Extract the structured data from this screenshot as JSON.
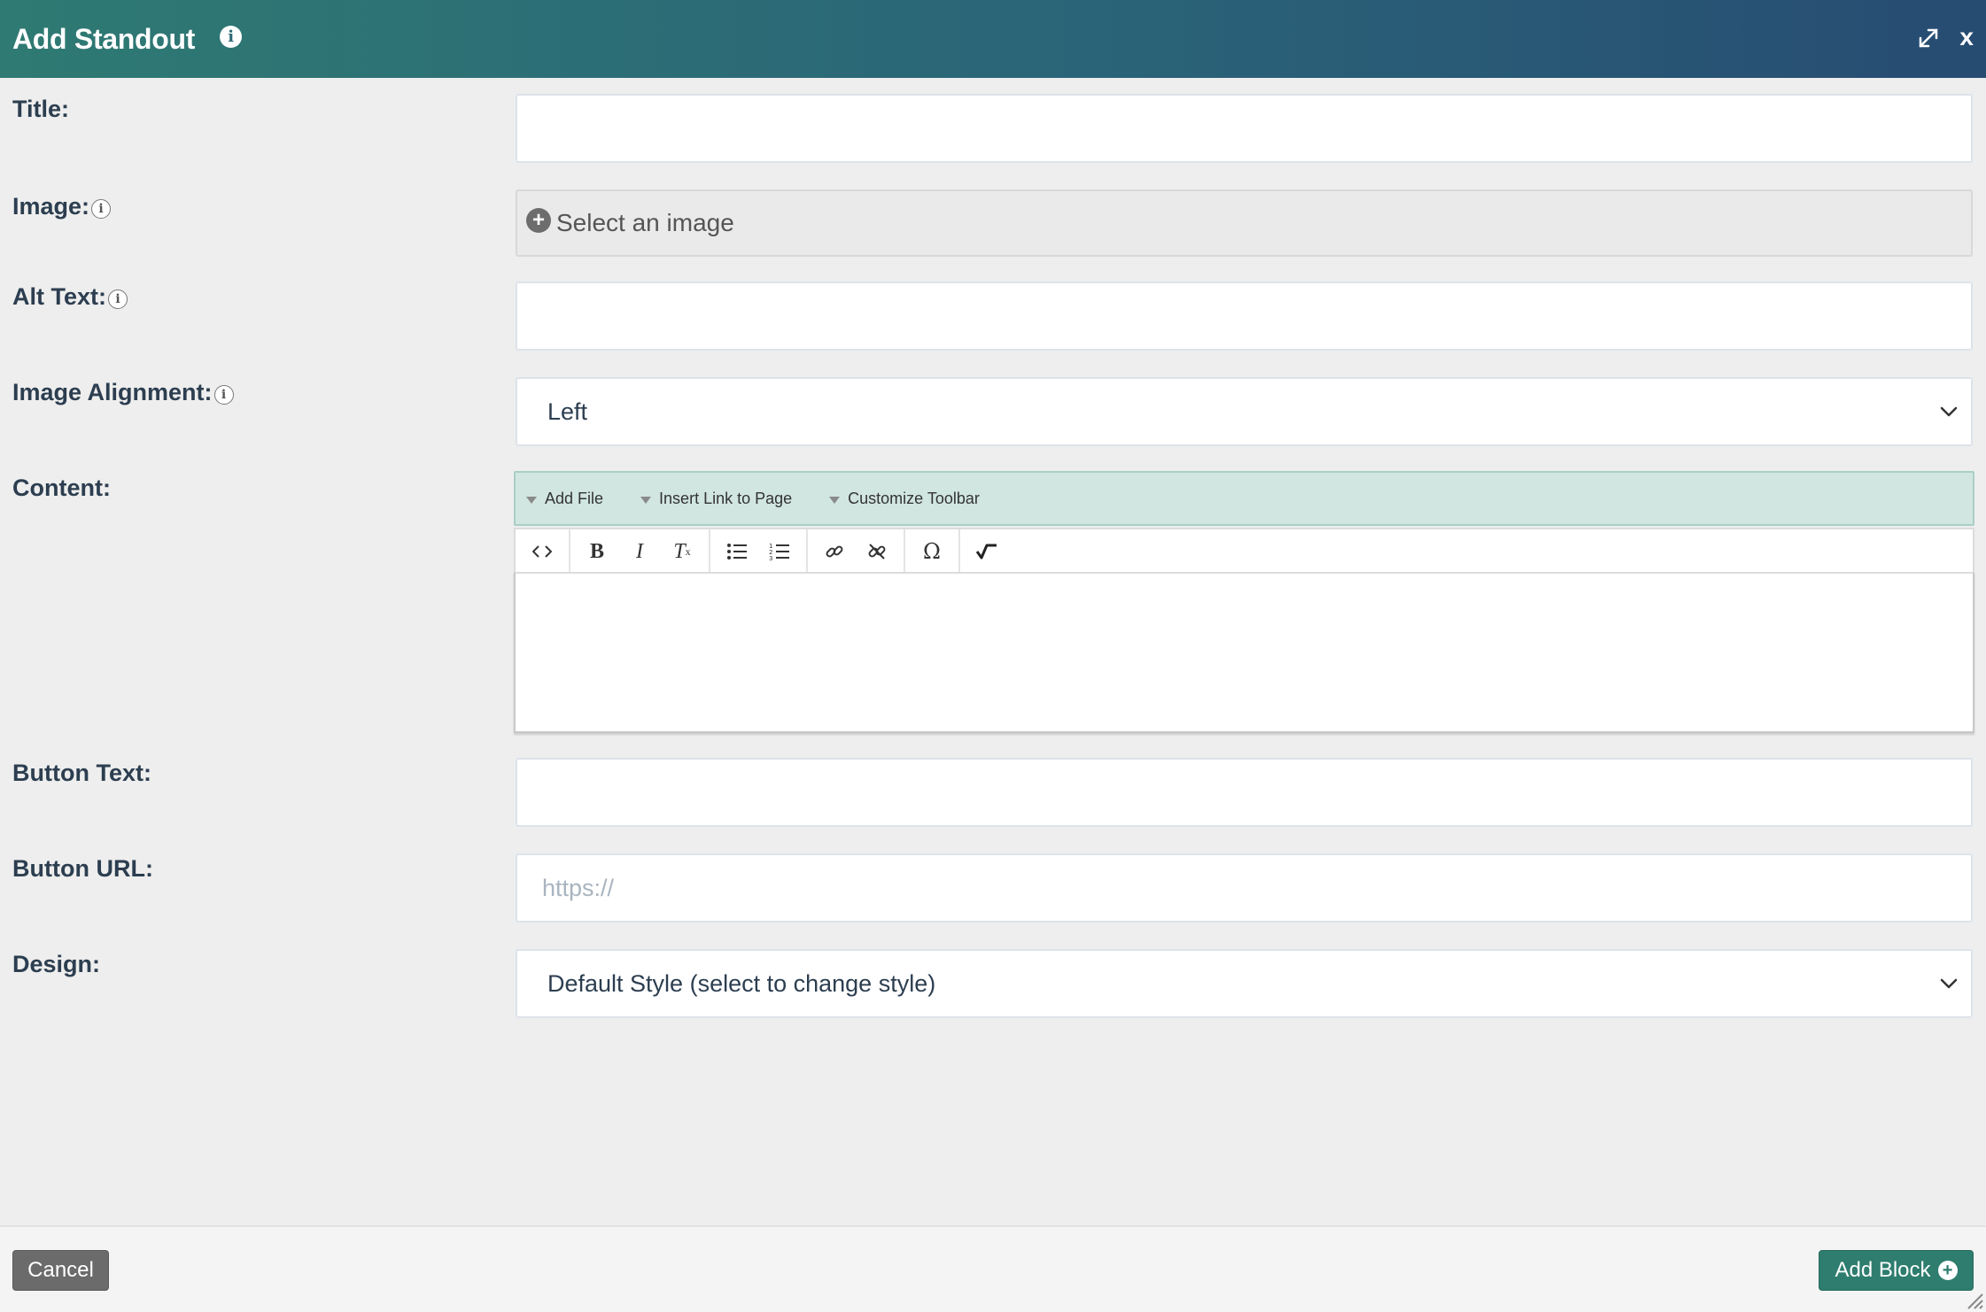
{
  "dialog": {
    "title": "Add Standout",
    "info_icon": "info-icon",
    "expand_icon": "expand-icon",
    "close_label": "x"
  },
  "form": {
    "title_label": "Title:",
    "title_value": "",
    "image_label": "Image:",
    "image_button": "Select an image",
    "alt_label": "Alt Text:",
    "alt_value": "",
    "alignment_label": "Image Alignment:",
    "alignment_value": "Left",
    "content_label": "Content:",
    "button_text_label": "Button Text:",
    "button_text_value": "",
    "button_url_label": "Button URL:",
    "button_url_placeholder": "https://",
    "design_label": "Design:",
    "design_value": "Default Style (select to change style)"
  },
  "editor": {
    "topbar": [
      {
        "label": "Add File"
      },
      {
        "label": "Insert Link to Page"
      },
      {
        "label": "Customize Toolbar"
      }
    ],
    "toolbar_icons": [
      "source-code-icon",
      "bold-icon",
      "italic-icon",
      "remove-format-icon",
      "bulleted-list-icon",
      "numbered-list-icon",
      "link-icon",
      "unlink-icon",
      "special-character-icon",
      "math-icon"
    ]
  },
  "footer": {
    "cancel_label": "Cancel",
    "add_label": "Add Block"
  },
  "colors": {
    "header_start": "#2f7a73",
    "header_end": "#274c72",
    "primary_button": "#2e7d6e",
    "cancel_button": "#6b6b6b",
    "editor_topbar": "#d1e6e1"
  }
}
